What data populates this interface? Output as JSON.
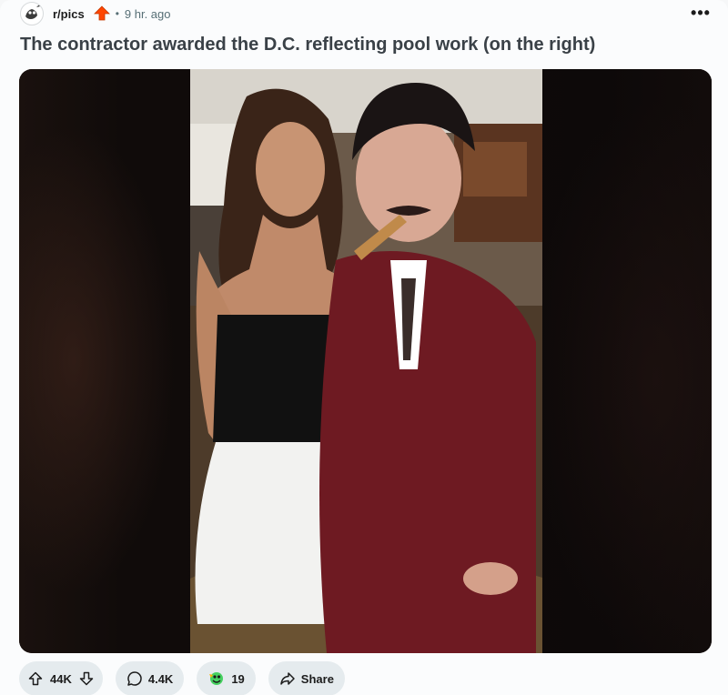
{
  "post": {
    "subreddit": "r/pics",
    "separator": "•",
    "time_ago": "9 hr. ago",
    "more_label": "•••",
    "title": "The contractor awarded the D.C. reflecting pool work (on the right)"
  },
  "actions": {
    "upvotes": "44K",
    "comments": "4.4K",
    "awards": "19",
    "share": "Share"
  },
  "colors": {
    "page_bg": "#fbfcfd",
    "pill_bg": "#e5ebee",
    "title_color": "#3a4147",
    "upvote_badge": "#ff4500",
    "meta_gray": "#576f76"
  },
  "icons": {
    "avatar": "subreddit-avatar-icon",
    "badge": "upvote-arrow-badge-icon",
    "upvote": "upvote-arrow-icon",
    "downvote": "downvote-arrow-icon",
    "comment": "comment-bubble-icon",
    "award": "award-icon",
    "share": "share-arrow-icon"
  }
}
